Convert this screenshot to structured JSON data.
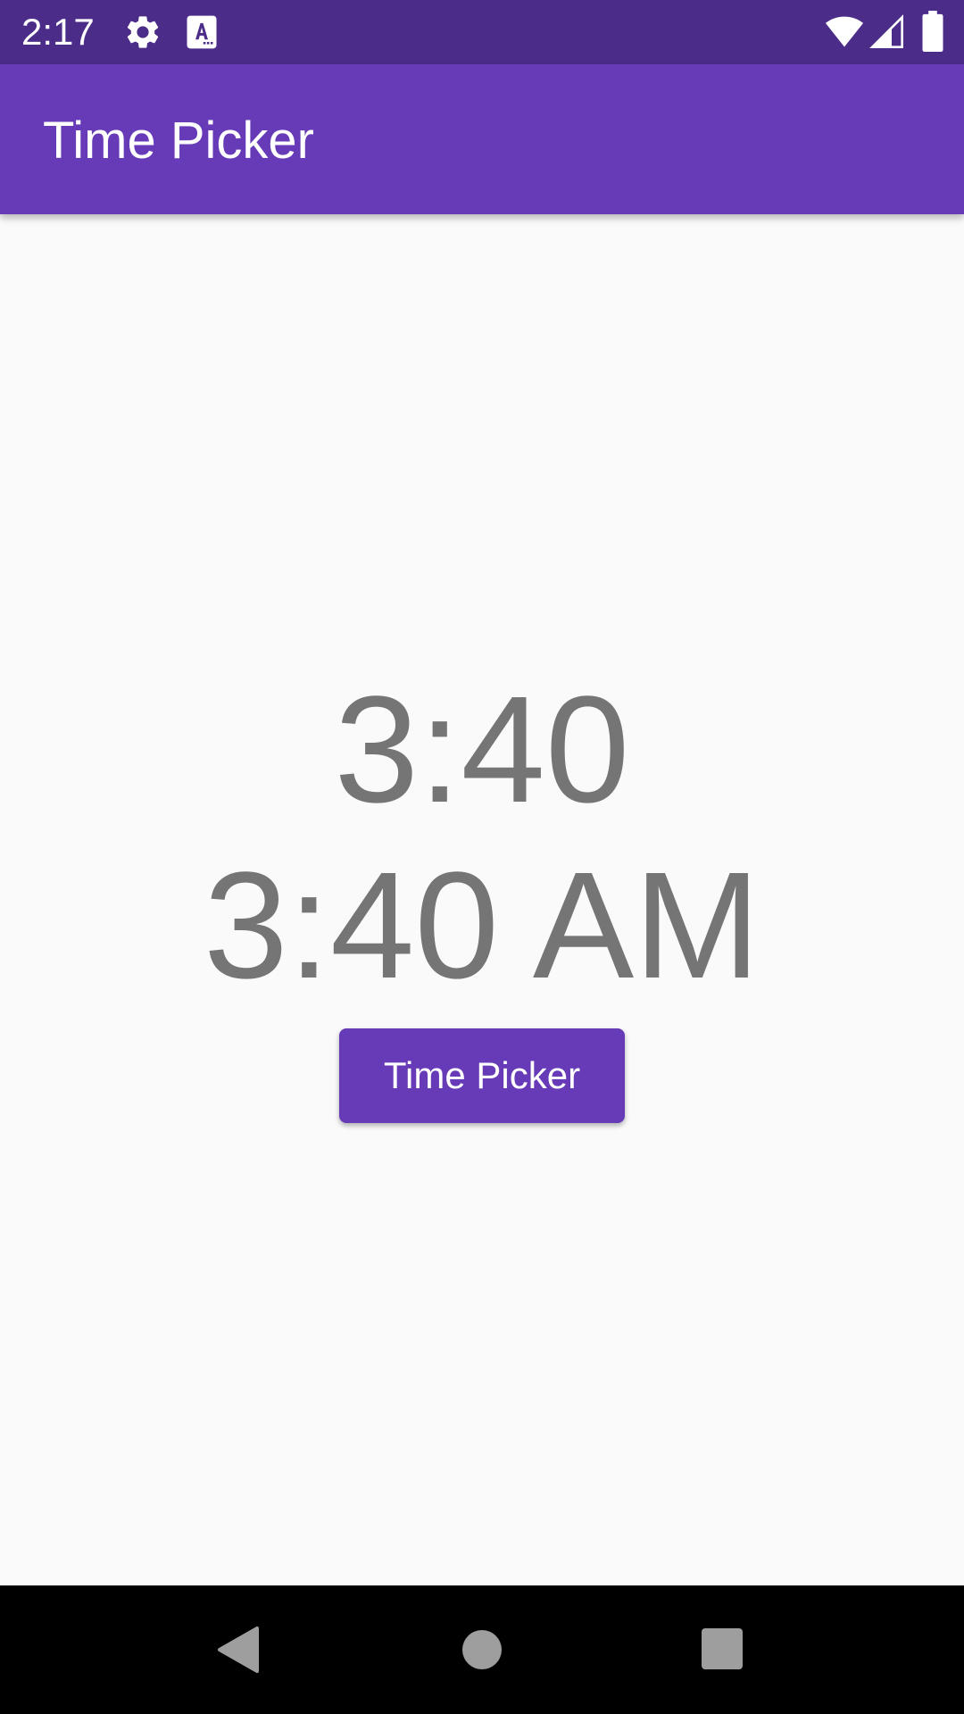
{
  "status_bar": {
    "time": "2:17",
    "color": "#4b2c89",
    "icons": [
      "settings-icon",
      "keyboard-icon",
      "wifi-icon",
      "cell-signal-icon",
      "battery-icon"
    ]
  },
  "app_bar": {
    "title": "Time Picker",
    "color": "#673ab7"
  },
  "main": {
    "time_24h": "3:40",
    "time_12h": "3:40 AM",
    "button_label": "Time Picker",
    "text_color": "#757575",
    "accent": "#673ab7"
  },
  "nav_bar": {
    "buttons": [
      "back-icon",
      "home-icon",
      "recents-icon"
    ]
  }
}
